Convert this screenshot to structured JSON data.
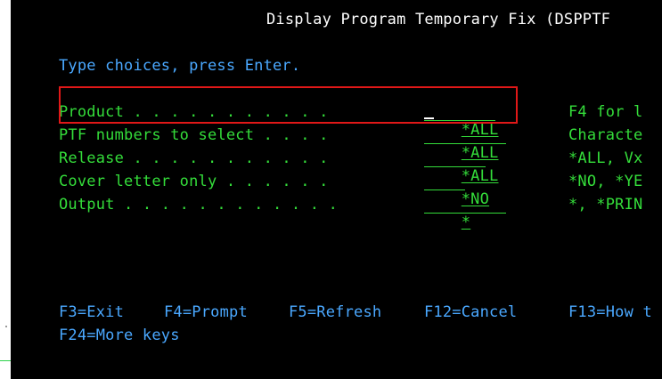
{
  "screen": {
    "title": "Display Program Temporary Fix (DSPPTF",
    "instruction": "Type choices, press Enter.",
    "fields": [
      {
        "label": "Product . . . . . . . . . . . ",
        "value": "*ALL",
        "help": "F4 for l"
      },
      {
        "label": "PTF numbers to select . . . . ",
        "value": "*ALL",
        "help": "Characte"
      },
      {
        "label": "Release . . . . . . . . . . . ",
        "value": "*ALL",
        "help": "*ALL, Vx"
      },
      {
        "label": "Cover letter only . . . . . . ",
        "value": "*NO",
        "help": "*NO, *YE"
      },
      {
        "label": "Output . . . . . . . . . . . .",
        "value": "*",
        "help": "*, *PRIN"
      }
    ],
    "function_keys": {
      "line1": [
        "F3=Exit",
        "F4=Prompt",
        "F5=Refresh",
        "F12=Cancel",
        "F13=How t"
      ],
      "line2": [
        "F24=More keys"
      ]
    }
  },
  "colors": {
    "background": "#000000",
    "title": "#ffffff",
    "instruction": "#4aa8ff",
    "field": "#34dd3a",
    "highlight": "#e01818"
  }
}
